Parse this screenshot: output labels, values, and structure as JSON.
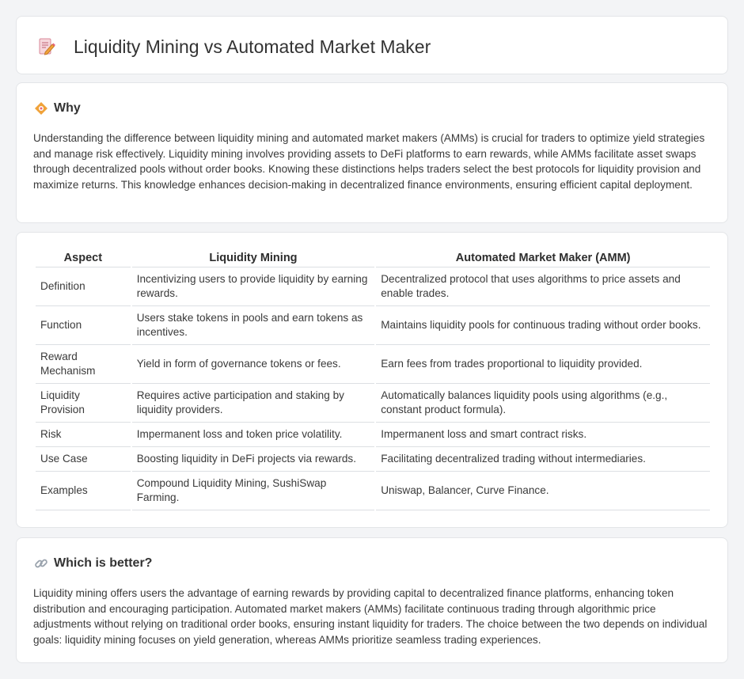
{
  "header": {
    "title": "Liquidity Mining vs Automated Market Maker",
    "icon": "document-pencil-icon"
  },
  "why": {
    "title": "Why",
    "icon": "diamond-badge-icon",
    "text": "Understanding the difference between liquidity mining and automated market makers (AMMs) is crucial for traders to optimize yield strategies and manage risk effectively. Liquidity mining involves providing assets to DeFi platforms to earn rewards, while AMMs facilitate asset swaps through decentralized pools without order books. Knowing these distinctions helps traders select the best protocols for liquidity provision and maximize returns. This knowledge enhances decision-making in decentralized finance environments, ensuring efficient capital deployment."
  },
  "table": {
    "headers": [
      "Aspect",
      "Liquidity Mining",
      "Automated Market Maker (AMM)"
    ],
    "rows": [
      [
        "Definition",
        "Incentivizing users to provide liquidity by earning rewards.",
        "Decentralized protocol that uses algorithms to price assets and enable trades."
      ],
      [
        "Function",
        "Users stake tokens in pools and earn tokens as incentives.",
        "Maintains liquidity pools for continuous trading without order books."
      ],
      [
        "Reward Mechanism",
        "Yield in form of governance tokens or fees.",
        "Earn fees from trades proportional to liquidity provided."
      ],
      [
        "Liquidity Provision",
        "Requires active participation and staking by liquidity providers.",
        "Automatically balances liquidity pools using algorithms (e.g., constant product formula)."
      ],
      [
        "Risk",
        "Impermanent loss and token price volatility.",
        "Impermanent loss and smart contract risks."
      ],
      [
        "Use Case",
        "Boosting liquidity in DeFi projects via rewards.",
        "Facilitating decentralized trading without intermediaries."
      ],
      [
        "Examples",
        "Compound Liquidity Mining, SushiSwap Farming.",
        "Uniswap, Balancer, Curve Finance."
      ]
    ]
  },
  "better": {
    "title": "Which is better?",
    "icon": "link-icon",
    "text": "Liquidity mining offers users the advantage of earning rewards by providing capital to decentralized finance platforms, enhancing token distribution and encouraging participation. Automated market makers (AMMs) facilitate continuous trading through algorithmic price adjustments without relying on traditional order books, ensuring instant liquidity for traders. The choice between the two depends on individual goals: liquidity mining focuses on yield generation, whereas AMMs prioritize seamless trading experiences."
  },
  "colors": {
    "background": "#f3f4f6",
    "card": "#ffffff",
    "border": "#e3e5e8",
    "accent_orange": "#f0a23a",
    "icon_pink": "#e8637a"
  }
}
